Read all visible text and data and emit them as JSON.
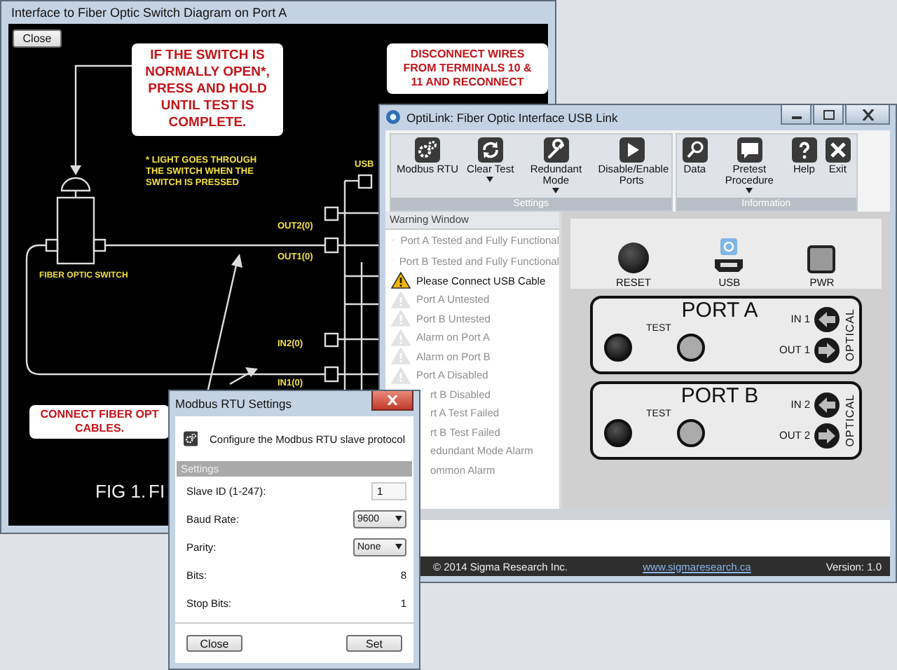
{
  "diagram_window": {
    "title": "Interface to Fiber Optic Switch Diagram on Port A",
    "close_button": "Close",
    "callouts": [
      {
        "lines": [
          "IF THE SWITCH IS",
          "NORMALLY OPEN*,",
          "PRESS AND HOLD",
          "UNTIL TEST IS",
          "COMPLETE."
        ]
      },
      {
        "lines": [
          "DISCONNECT WIRES",
          "FROM TERMINALS 10 &",
          "11 AND RECONNECT"
        ]
      },
      {
        "lines": [
          "CONNECT FIBER OPT",
          "CABLES."
        ]
      }
    ],
    "note": [
      "* LIGHT GOES THROUGH",
      "THE SWITCH WHEN THE",
      "SWITCH IS PRESSED"
    ],
    "switch_label": "FIBER OPTIC SWITCH",
    "terminals": [
      "USB",
      "OUT2(0)",
      "OUT1(0)",
      "IN2(0)",
      "IN1(0)"
    ],
    "caption": [
      "FIG 1.",
      "FI"
    ]
  },
  "main_window": {
    "title": "OptiLink: Fiber Optic Interface USB Link",
    "ribbon_groups": [
      {
        "label": "Settings",
        "buttons": [
          {
            "label": "Modbus RTU",
            "dropdown": false
          },
          {
            "label": "Clear Test",
            "dropdown": true
          },
          {
            "label": "Redundant Mode",
            "dropdown": true
          },
          {
            "label": "Disable/Enable Ports",
            "dropdown": false
          }
        ]
      },
      {
        "label": "Information",
        "buttons": [
          {
            "label": "Data",
            "dropdown": false
          },
          {
            "label": "Pretest Procedure",
            "dropdown": true
          },
          {
            "label": "Help",
            "dropdown": false
          },
          {
            "label": "Exit",
            "dropdown": false
          }
        ]
      }
    ],
    "warning_window": {
      "title": "Warning Window",
      "items": [
        {
          "text": "Port A Tested and Fully Functional",
          "kind": "check",
          "active": false
        },
        {
          "text": "Port B Tested and Fully Functional",
          "kind": "check",
          "active": false
        },
        {
          "text": "Please Connect USB Cable",
          "kind": "warning",
          "active": true
        },
        {
          "text": "Port A Untested",
          "kind": "warning",
          "active": false
        },
        {
          "text": "Port B Untested",
          "kind": "warning",
          "active": false
        },
        {
          "text": "Alarm on Port A",
          "kind": "warning",
          "active": false
        },
        {
          "text": "Alarm on Port B",
          "kind": "warning",
          "active": false
        },
        {
          "text": "Port A Disabled",
          "kind": "warning",
          "active": false
        }
      ],
      "covered_items": [
        "rt B Disabled",
        "rt A Test Failed",
        "rt B Test Failed",
        "edundant Mode Alarm",
        "ommon Alarm"
      ]
    },
    "device": {
      "reset": "RESET",
      "usb": "USB",
      "power": "PWR",
      "ports": [
        {
          "title": "PORT A",
          "test": "TEST",
          "in": "IN 1",
          "out": "OUT 1",
          "side": "OPTICAL"
        },
        {
          "title": "PORT B",
          "test": "TEST",
          "in": "IN 2",
          "out": "OUT 2",
          "side": "OPTICAL"
        }
      ]
    },
    "footer": {
      "copyright": "© 2014 Sigma Research Inc.",
      "link": "www.sigmaresearch.ca",
      "version": "Version: 1.0"
    }
  },
  "dialog": {
    "title": "Modbus RTU Settings",
    "description": "Configure the Modbus RTU slave protocol",
    "section": "Settings",
    "fields": [
      {
        "label": "Slave ID (1-247):",
        "kind": "input",
        "value": "1"
      },
      {
        "label": "Baud Rate:",
        "kind": "select",
        "value": "9600"
      },
      {
        "label": "Parity:",
        "kind": "select",
        "value": "None"
      },
      {
        "label": "Bits:",
        "kind": "text",
        "value": "8"
      },
      {
        "label": "Stop Bits:",
        "kind": "text",
        "value": "1"
      }
    ],
    "buttons": [
      "Close",
      "Set"
    ]
  }
}
